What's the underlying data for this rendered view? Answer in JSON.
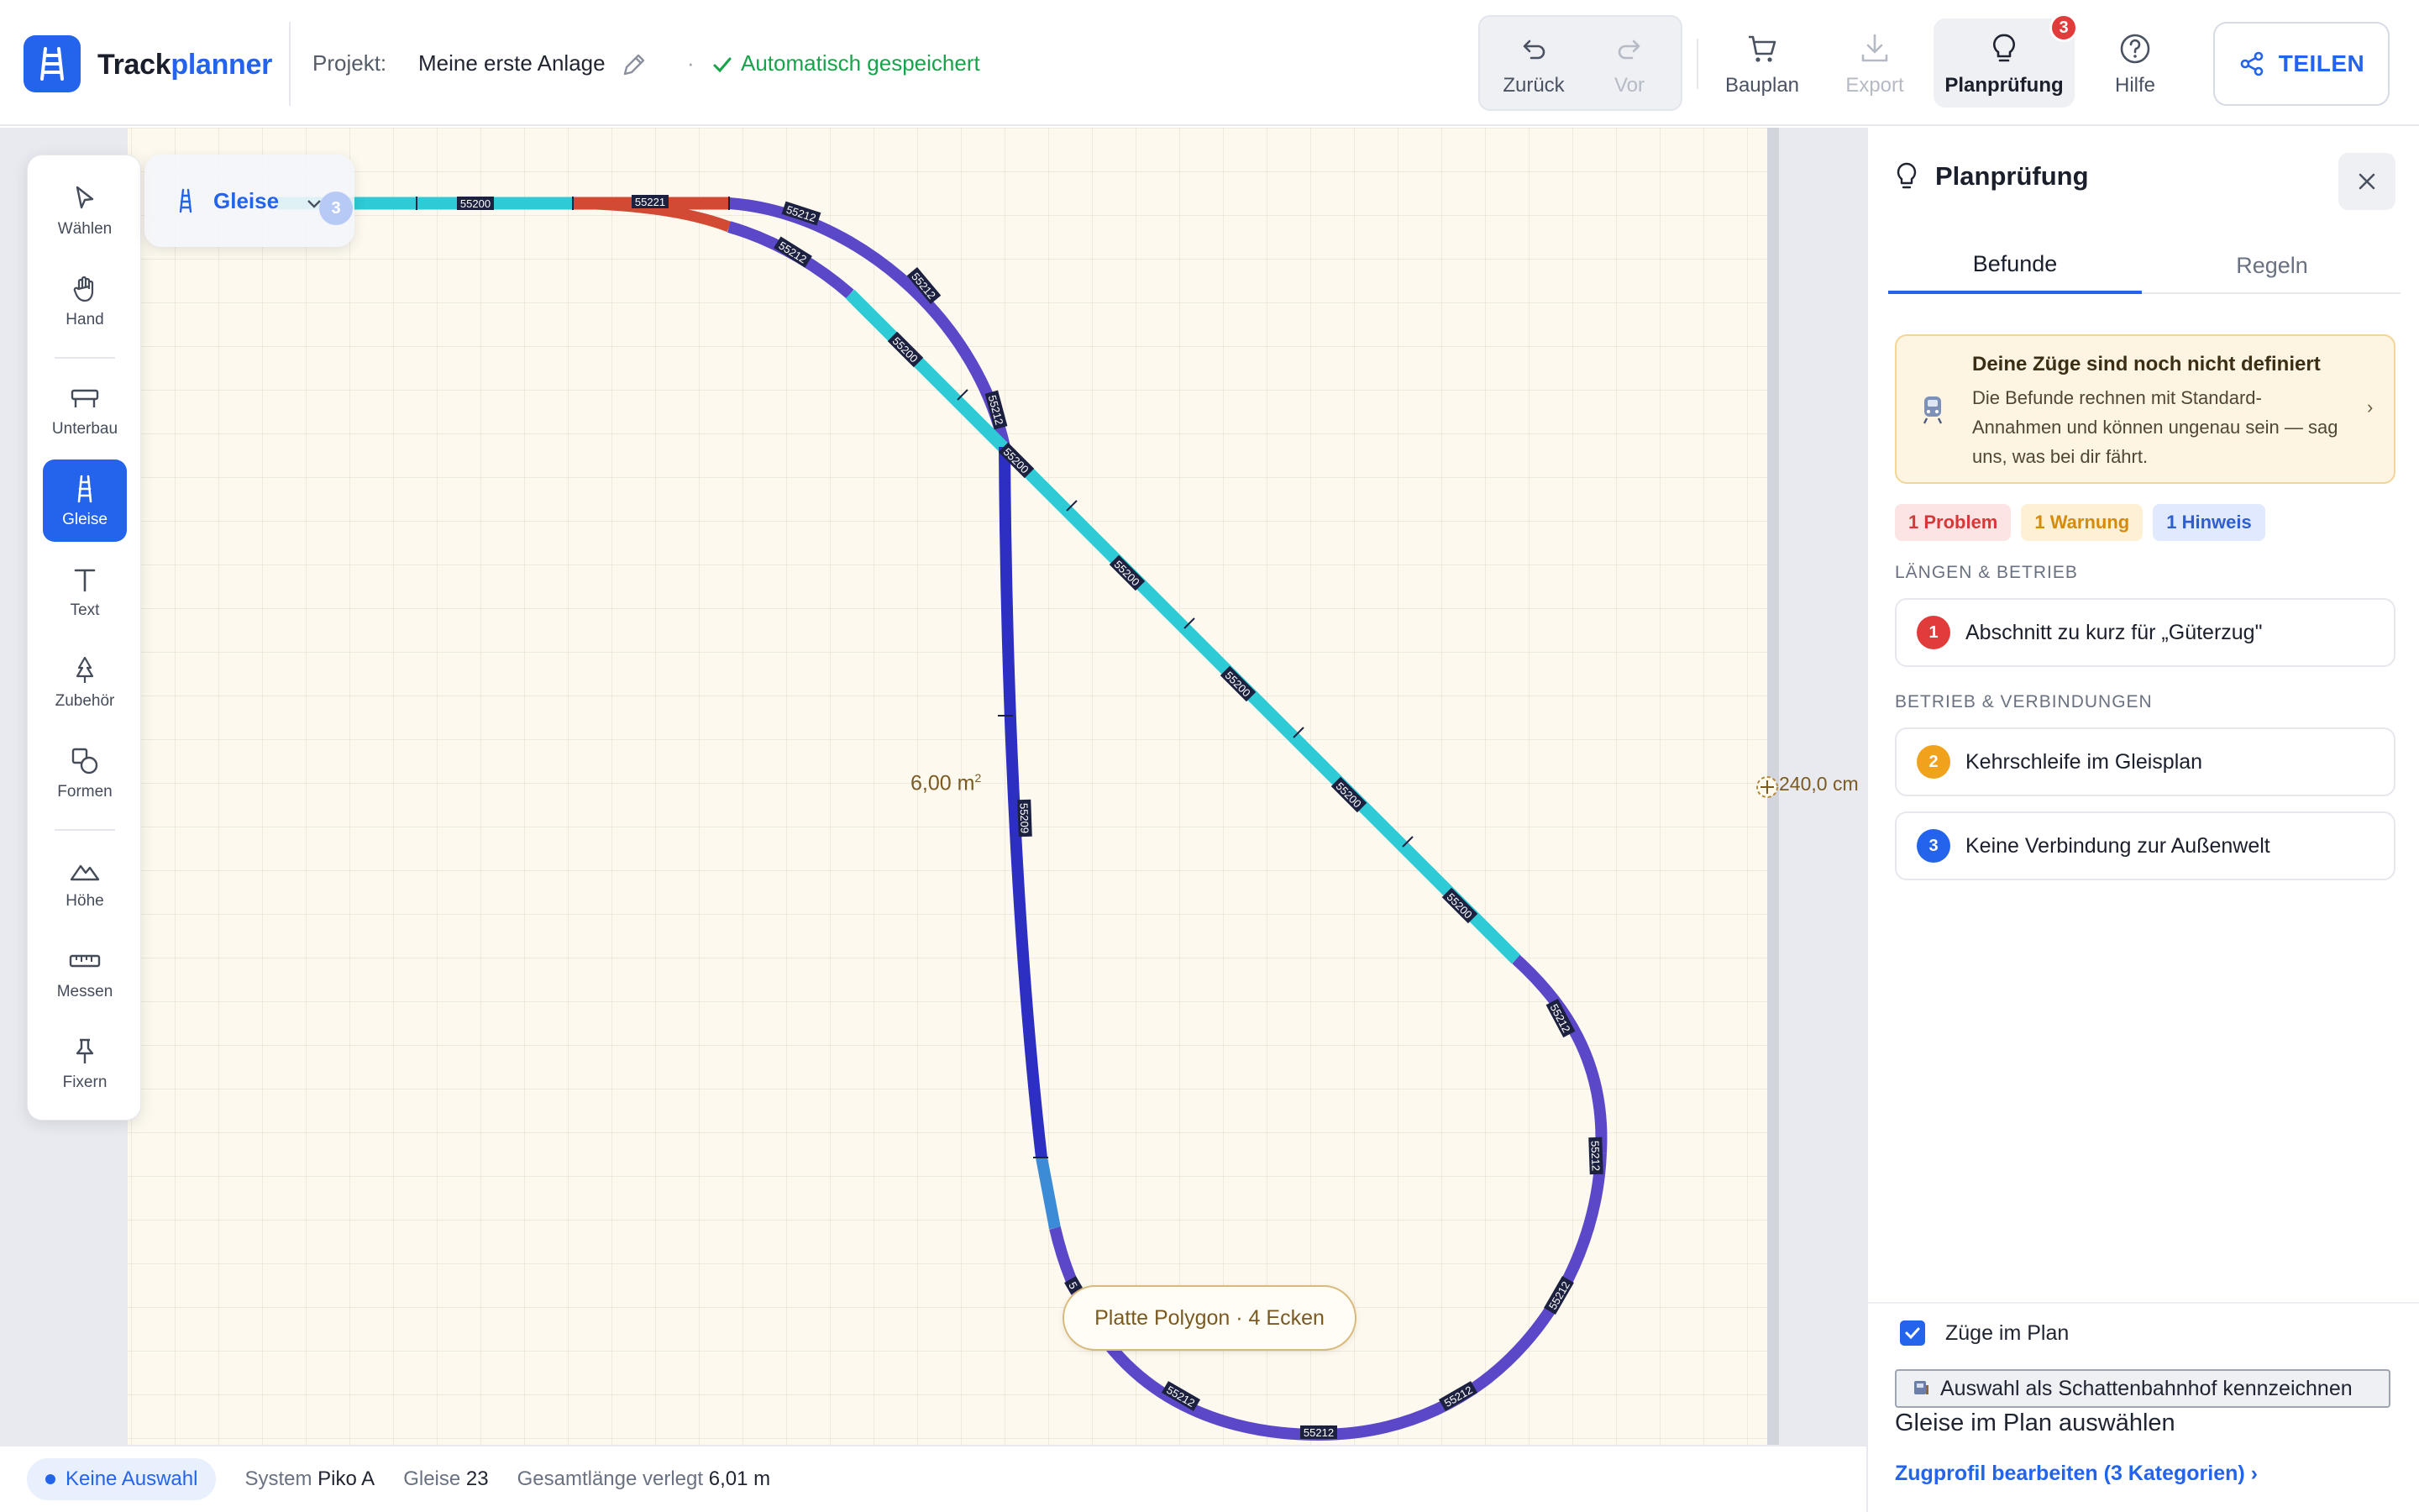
{
  "app": {
    "brand_part1": "Track",
    "brand_part2": "planner",
    "project_label": "Projekt:",
    "project_name": "Meine erste Anlage",
    "separator": "·",
    "save_status": "Automatisch gespeichert"
  },
  "toolbar": {
    "undo": "Zurück",
    "redo": "Vor",
    "bauplan": "Bauplan",
    "export": "Export",
    "planpruefung": "Planprüfung",
    "planpruefung_badge": "3",
    "hilfe": "Hilfe",
    "share": "TEILEN"
  },
  "tools": [
    {
      "label": "Wählen",
      "icon": "cursor-icon"
    },
    {
      "label": "Hand",
      "icon": "hand-icon"
    },
    {
      "label": "Unterbau",
      "icon": "bench-icon"
    },
    {
      "label": "Gleise",
      "icon": "track-icon",
      "active": true
    },
    {
      "label": "Text",
      "icon": "text-icon"
    },
    {
      "label": "Zubehör",
      "icon": "tree-icon"
    },
    {
      "label": "Formen",
      "icon": "shapes-icon"
    },
    {
      "label": "Höhe",
      "icon": "mountain-icon"
    },
    {
      "label": "Messen",
      "icon": "ruler-icon"
    },
    {
      "label": "Fixern",
      "icon": "pin-icon"
    }
  ],
  "layer_pill": {
    "label": "Gleise",
    "count": "3"
  },
  "canvas": {
    "area": "6,00 m",
    "area_unit_sup": "2",
    "width": "240,0 cm",
    "plate": "Platte Polygon · 4 Ecken",
    "track_labels": {
      "straight": "55200",
      "curve": "55212",
      "red": "55221",
      "center": "55209",
      "bottom_small": "5"
    },
    "colors": {
      "plate_fill": "#fdf9ef",
      "straight_track": "#2ecad6",
      "curve_track": "#5b48c8",
      "dark_track": "#2d2fc2",
      "red_track": "#d24a33",
      "mid_blue_track": "#3b8bd6"
    }
  },
  "statusbar": {
    "selection": "Keine Auswahl",
    "system_label": "System",
    "system_value": "Piko A",
    "tracks_label": "Gleise",
    "tracks_value": "23",
    "length_label": "Gesamtlänge verlegt",
    "length_value": "6,01 m"
  },
  "panel": {
    "title": "Planprüfung",
    "tabs": [
      "Befunde",
      "Regeln"
    ],
    "notice": {
      "title": "Deine Züge sind noch nicht definiert",
      "text": "Die Befunde rechnen mit Standard-Annahmen und können ungenau sein — sag uns, was bei dir fährt."
    },
    "chips": {
      "problem": "1 Problem",
      "warning": "1 Warnung",
      "hint": "1 Hinweis"
    },
    "section1": "LÄNGEN & BETRIEB",
    "section2": "BETRIEB & VERBINDUNGEN",
    "findings": [
      {
        "num": "1",
        "text": "Abschnitt zu kurz für „Güterzug\"",
        "color": "#e23b3b"
      },
      {
        "num": "2",
        "text": "Kehrschleife im Gleisplan",
        "color": "#f0a21c"
      },
      {
        "num": "3",
        "text": "Keine Verbindung zur Außenwelt",
        "color": "#2463eb"
      }
    ],
    "checkbox_label": "Züge im Plan",
    "shadow_button": "Auswahl als Schattenbahnhof kennzeichnen",
    "select_text": "Gleise im Plan auswählen",
    "profile_link": "Zugprofil bearbeiten (3 Kategorien) ›"
  }
}
